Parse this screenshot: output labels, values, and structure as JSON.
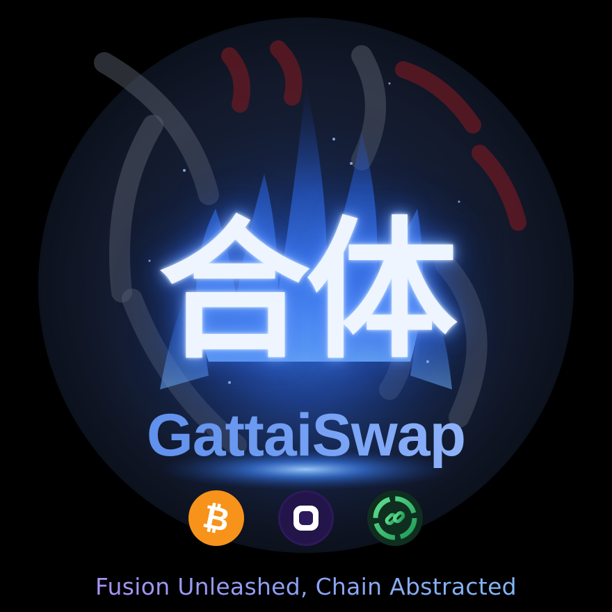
{
  "hero": {
    "kanji": "合体",
    "brand_name": "GattaiSwap",
    "tagline": "Fusion Unleashed, Chain Abstracted"
  },
  "logos": [
    {
      "name": "bitcoin-icon",
      "symbol": "₿",
      "color": "#f7931a"
    },
    {
      "name": "purple-square-icon",
      "color": "#2c1a5c"
    },
    {
      "name": "chain-link-icon",
      "color": "#2ebd6b"
    }
  ],
  "colors": {
    "background": "#000000",
    "emblem_circle": "#151b2a",
    "flame_blue": "#3a7cff",
    "accent_red": "#6e1a22",
    "brand_gradient": [
      "#4e83e6",
      "#a6c3ff"
    ],
    "tagline_gradient": [
      "#b58cf2",
      "#7ec0f4"
    ]
  }
}
